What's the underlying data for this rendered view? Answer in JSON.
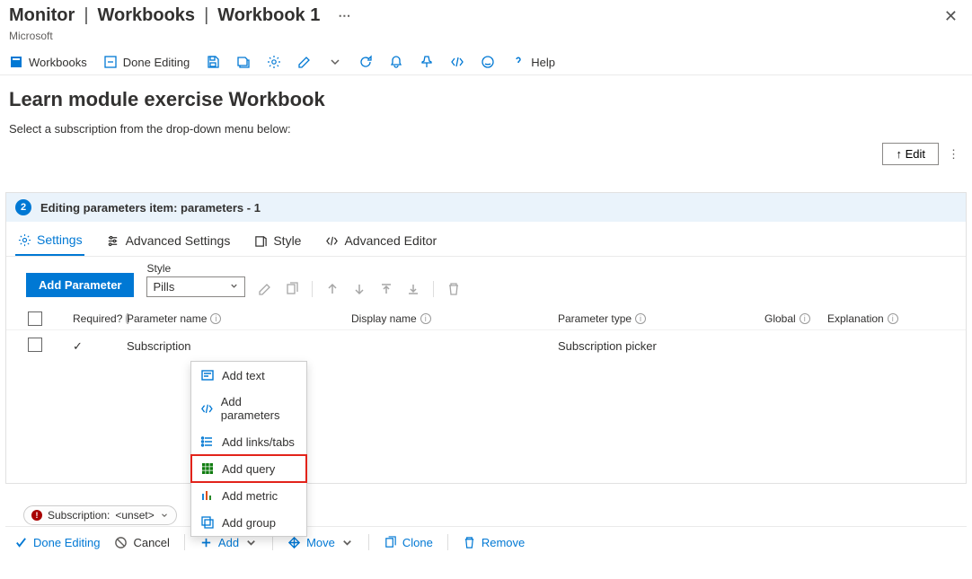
{
  "header": {
    "title_main": "Monitor",
    "title_crumb1": "Workbooks",
    "title_crumb2": "Workbook 1",
    "subtitle": "Microsoft"
  },
  "toolbar": {
    "workbooks": "Workbooks",
    "done_editing": "Done Editing",
    "help": "Help"
  },
  "section": {
    "title": "Learn module exercise Workbook",
    "desc": "Select a subscription from the drop-down menu below:",
    "edit_label": "↑ Edit"
  },
  "param_block": {
    "step_num": "2",
    "header": "Editing parameters item: parameters - 1"
  },
  "tabs": {
    "settings": "Settings",
    "advanced": "Advanced Settings",
    "style": "Style",
    "editor": "Advanced Editor"
  },
  "controls": {
    "add_parameter": "Add Parameter",
    "style_label": "Style",
    "style_value": "Pills"
  },
  "columns": {
    "required": "Required?",
    "param_name": "Parameter name",
    "display_name": "Display name",
    "param_type": "Parameter type",
    "global": "Global",
    "explanation": "Explanation"
  },
  "rows": [
    {
      "name": "Subscription",
      "type": "Subscription picker"
    }
  ],
  "menu": {
    "add_text": "Add text",
    "add_parameters": "Add parameters",
    "add_links": "Add links/tabs",
    "add_query": "Add query",
    "add_metric": "Add metric",
    "add_group": "Add group"
  },
  "pill": {
    "label": "Subscription:",
    "value": "<unset>"
  },
  "bottom": {
    "done": "Done Editing",
    "cancel": "Cancel",
    "add": "Add",
    "move": "Move",
    "clone": "Clone",
    "remove": "Remove"
  }
}
